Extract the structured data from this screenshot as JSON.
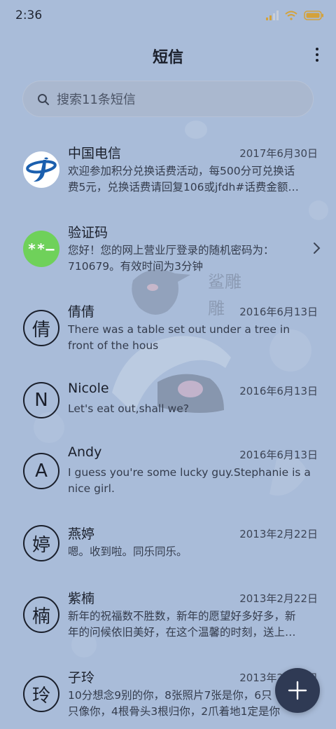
{
  "status": {
    "time": "2:36"
  },
  "header": {
    "title": "短信"
  },
  "search": {
    "placeholder": "搜索11条短信"
  },
  "conversations": [
    {
      "name": "中国电信",
      "date": "2017年6月30日",
      "preview": "欢迎参加积分兑换话费活动，每500分可兑换话\n费5元，兑换话费请回复106或jfdh#话费金额…",
      "avatar": "telecom-logo"
    },
    {
      "name": "验证码",
      "date": "",
      "preview": "您好！您的网上营业厅登录的随机密码为：\n710679。有效时间为3分钟",
      "avatar_text": "**–"
    },
    {
      "name": "倩倩",
      "date": "2016年6月13日",
      "preview": "There was a table set out under a tree in\nfront of the hous",
      "avatar_text": "倩"
    },
    {
      "name": "Nicole",
      "date": "2016年6月13日",
      "preview": "Let's eat out,shall we?",
      "avatar_text": "N"
    },
    {
      "name": "Andy",
      "date": "2016年6月13日",
      "preview": "I guess you're some lucky guy.Stephanie is a\nnice girl.",
      "avatar_text": "A"
    },
    {
      "name": "燕婷",
      "date": "2013年2月22日",
      "preview": "嗯。收到啦。同乐同乐。",
      "avatar_text": "婷"
    },
    {
      "name": "紫楠",
      "date": "2013年2月22日",
      "preview": "新年的祝福数不胜数，新年的愿望好多好多，新\n年的问候依旧美好，在这个温馨的时刻，送上…",
      "avatar_text": "楠"
    },
    {
      "name": "子玲",
      "date": "2013年2月22日",
      "preview": "10分想念9别的你，8张照片7张是你，6只\n只像你，4根骨头3根归你，2爪着地1定是你",
      "avatar_text": "玲"
    }
  ],
  "wallpaper_text": "鲨雕",
  "colors": {
    "background": "#a9bcd9",
    "code_avatar": "#6fd15a",
    "telecom_blue": "#1b5fae",
    "fab": "#2f3a54"
  }
}
